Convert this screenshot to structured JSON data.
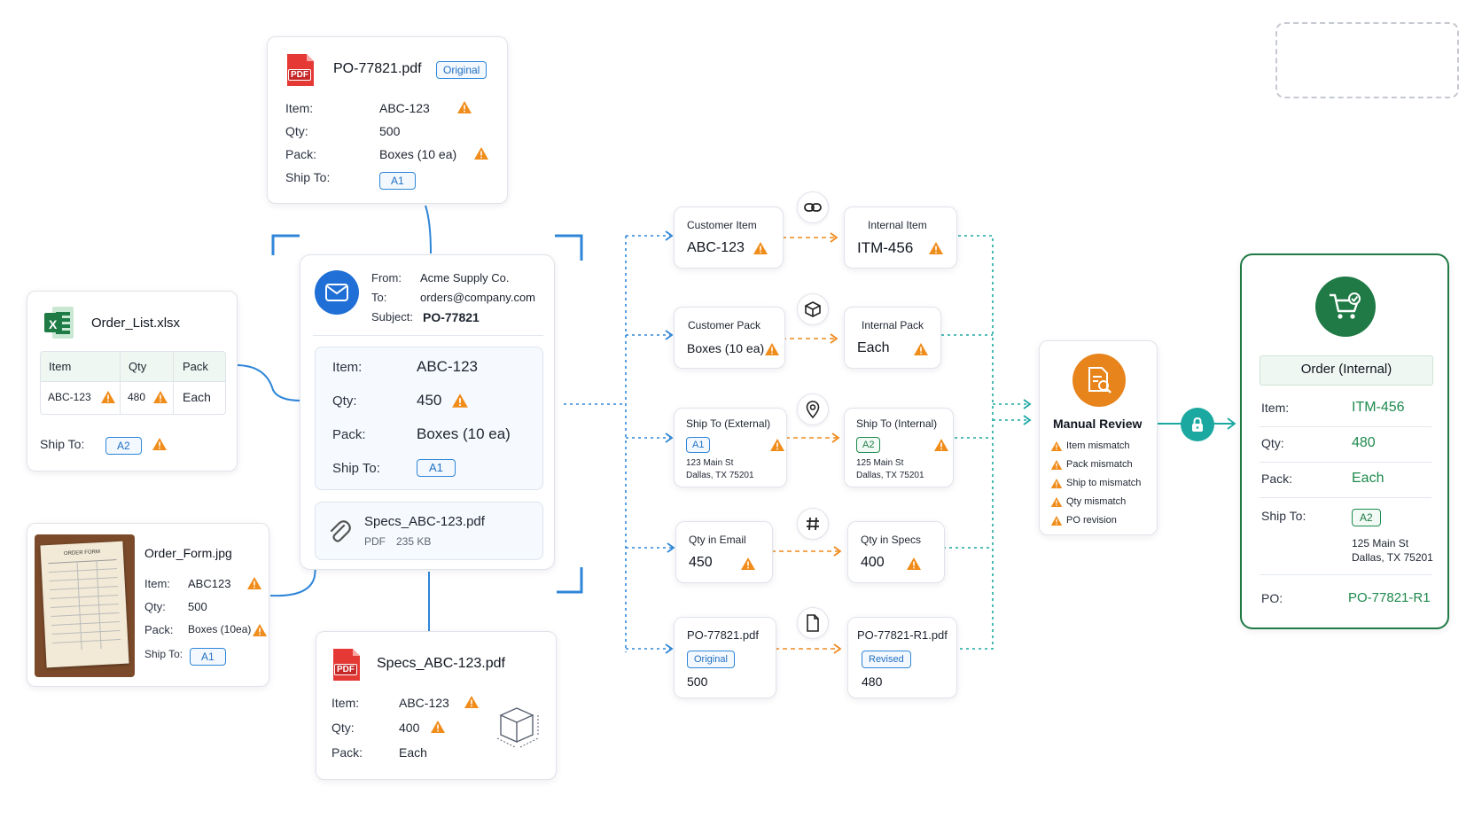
{
  "po_card": {
    "filename": "PO-77821.pdf",
    "badge": "Original",
    "icon_text": "PDF",
    "fields": [
      {
        "label": "Item:",
        "value": "ABC-123"
      },
      {
        "label": "Qty:",
        "value": "500"
      },
      {
        "label": "Pack:",
        "value": "Boxes (10 ea)"
      },
      {
        "label": "Ship To:",
        "value": "A1"
      }
    ]
  },
  "xlsx_card": {
    "filename": "Order_List.xlsx",
    "icon_text": "X",
    "headers": [
      "Item",
      "Qty",
      "Pack"
    ],
    "row": [
      "ABC-123",
      "480",
      "Each"
    ],
    "ship_label": "Ship To:",
    "ship_value": "A2"
  },
  "jpg_card": {
    "filename": "Order_Form.jpg",
    "thumb_text": "ORDER FORM",
    "fields": [
      {
        "label": "Item:",
        "value": "ABC123"
      },
      {
        "label": "Qty:",
        "value": "500"
      },
      {
        "label": "Pack:",
        "value": "Boxes (10ea)"
      },
      {
        "label": "Ship To:",
        "value": "A1"
      }
    ]
  },
  "email_card": {
    "from_label": "From:",
    "from_value": "Acme Supply Co.",
    "to_label": "To:",
    "to_value": "orders@company.com",
    "subject_label": "Subject:",
    "subject_value": "PO-77821",
    "fields": [
      {
        "label": "Item:",
        "value": "ABC-123"
      },
      {
        "label": "Qty:",
        "value": "450"
      },
      {
        "label": "Pack:",
        "value": "Boxes (10 ea)"
      },
      {
        "label": "Ship To:",
        "value": "A1"
      }
    ],
    "attachment_name": "Specs_ABC-123.pdf",
    "attachment_type": "PDF",
    "attachment_size": "235 KB"
  },
  "specs_card": {
    "filename": "Specs_ABC-123.pdf",
    "icon_text": "PDF",
    "fields": [
      {
        "label": "Item:",
        "value": "ABC-123"
      },
      {
        "label": "Qty:",
        "value": "400"
      },
      {
        "label": "Pack:",
        "value": "Each"
      }
    ]
  },
  "mappings": [
    {
      "left_label": "Customer Item",
      "left_value": "ABC-123",
      "right_label": "Internal Item",
      "right_value": "ITM-456",
      "icon": "link-icon"
    },
    {
      "left_label": "Customer Pack",
      "left_value": "Boxes (10 ea)",
      "right_label": "Internal Pack",
      "right_value": "Each",
      "icon": "box-icon"
    },
    {
      "left_label": "Ship To (External)",
      "left_chip": "A1",
      "left_addr1": "123 Main St",
      "left_addr2": "Dallas, TX 75201",
      "right_label": "Ship To (Internal)",
      "right_chip": "A2",
      "right_addr1": "125 Main St",
      "right_addr2": "Dallas, TX 75201",
      "icon": "location-pin-icon"
    },
    {
      "left_label": "Qty in Email",
      "left_value": "450",
      "right_label": "Qty in Specs",
      "right_value": "400",
      "icon": "hash-icon"
    },
    {
      "left_label": "PO-77821.pdf",
      "left_chip": "Original",
      "left_value": "500",
      "right_label": "PO-77821-R1.pdf",
      "right_chip": "Revised",
      "right_value": "480",
      "icon": "document-icon"
    }
  ],
  "review": {
    "title": "Manual Review",
    "items": [
      "Item mismatch",
      "Pack mismatch",
      "Ship to mismatch",
      "Qty mismatch",
      "PO revision"
    ]
  },
  "order": {
    "title": "Order (Internal)",
    "item_label": "Item:",
    "item_value": "ITM-456",
    "qty_label": "Qty:",
    "qty_value": "480",
    "pack_label": "Pack:",
    "pack_value": "Each",
    "ship_label": "Ship To:",
    "ship_chip": "A2",
    "ship_addr1": "125 Main St",
    "ship_addr2": "Dallas, TX 75201",
    "po_label": "PO:",
    "po_value": "PO-77821-R1"
  },
  "colors": {
    "blue": "#2f86d8",
    "teal": "#1aa8a0",
    "orange": "#ef8a1c",
    "warn": "#f08c1a",
    "green": "#1f7a45",
    "pdf_red": "#e53935",
    "excel_green": "#1e7b45"
  }
}
